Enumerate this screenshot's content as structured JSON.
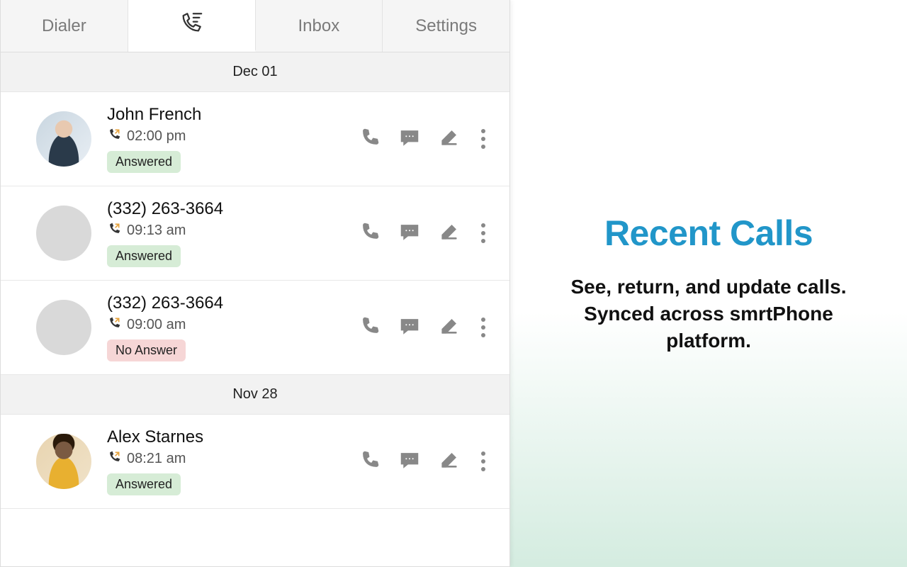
{
  "tabs": {
    "dialer": "Dialer",
    "inbox": "Inbox",
    "settings": "Settings"
  },
  "groups": [
    {
      "date": "Dec 01",
      "calls": [
        {
          "name": "John French",
          "time": "02:00 pm",
          "status": "Answered",
          "statusClass": "status-answered",
          "avatar": "photo1"
        },
        {
          "name": "(332) 263-3664",
          "time": "09:13 am",
          "status": "Answered",
          "statusClass": "status-answered",
          "avatar": ""
        },
        {
          "name": "(332) 263-3664",
          "time": "09:00 am",
          "status": "No Answer",
          "statusClass": "status-noanswer",
          "avatar": ""
        }
      ]
    },
    {
      "date": "Nov 28",
      "calls": [
        {
          "name": "Alex Starnes",
          "time": "08:21 am",
          "status": "Answered",
          "statusClass": "status-answered",
          "avatar": "photo2"
        }
      ]
    }
  ],
  "marketing": {
    "title": "Recent Calls",
    "line1": "See, return, and update calls.",
    "line2": "Synced across smrtPhone",
    "line3": "platform."
  }
}
